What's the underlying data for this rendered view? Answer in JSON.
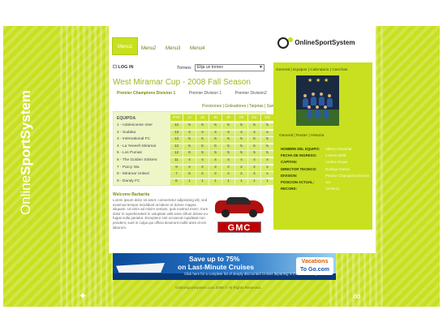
{
  "brand": {
    "prefix": "Online",
    "name": "SportSystem",
    "side_prefix": "Online",
    "side_name": "SportSystem"
  },
  "menu": [
    "Menu1",
    "Menu2",
    "Menu3",
    "Menu4"
  ],
  "login": "LOG IN",
  "season": {
    "label": "Torneo:",
    "selected": "Elija un torneo"
  },
  "page_title": "West Miramar Cup - 2008 Fall Season",
  "divisions": [
    "Premier Champions Division 1",
    "Premier Division 1",
    "Premier Division2"
  ],
  "sub_tabs": "Posiciones | Goleadores | Tarjetas | Sanciones",
  "standings": {
    "header": "EQUIPOA",
    "columns": [
      "PTS",
      "JJ",
      "JG",
      "JE",
      "JP",
      "GF",
      "GC",
      "GD"
    ],
    "rows": [
      {
        "team": "1 - Adolescente Inter",
        "vals": [
          "12",
          "5",
          "5",
          "5",
          "5",
          "5",
          "5",
          "5"
        ]
      },
      {
        "team": "2 - Sudaka",
        "vals": [
          "13",
          "4",
          "4",
          "4",
          "4",
          "4",
          "4",
          "4"
        ]
      },
      {
        "team": "3 - International FC",
        "vals": [
          "12",
          "5",
          "5",
          "5",
          "5",
          "5",
          "5",
          "5"
        ]
      },
      {
        "team": "4 - La Yeeeeh Miramar",
        "vals": [
          "12",
          "6",
          "5",
          "5",
          "5",
          "5",
          "5",
          "5"
        ]
      },
      {
        "team": "5 - Los Pumas",
        "vals": [
          "12",
          "6",
          "5",
          "5",
          "5",
          "5",
          "5",
          "5"
        ]
      },
      {
        "team": "6 - The Golden Strikers",
        "vals": [
          "11",
          "4",
          "4",
          "4",
          "4",
          "4",
          "4",
          "4"
        ]
      },
      {
        "team": "7 - Parcy Wa",
        "vals": [
          "9",
          "4",
          "2",
          "2",
          "2",
          "2",
          "2",
          "2"
        ]
      },
      {
        "team": "8 - Miramar United",
        "vals": [
          "7",
          "6",
          "2",
          "2",
          "2",
          "2",
          "2",
          "2"
        ]
      },
      {
        "team": "9 - Dandy FC",
        "vals": [
          "6",
          "1",
          "1",
          "1",
          "1",
          "1",
          "1",
          "1"
        ]
      }
    ]
  },
  "news": {
    "title": "Welcome Barbarita",
    "body": "Lorem ipsum dolor sit amet, consectetur adipisicing elit, sed eiusmod tempor incididunt ut labore et dolore magna aliquam. Ut enim ad minim veniam, quis nostrud exerc. Irure dolor in reprehenderit in voluptate velit esse cillum dolore eu fugiat nulla pariatur. Excepteur sint occaecat cupidatat non proident, sunt in culpa qui officia deserunt mollit anim id est laborum."
  },
  "ad": {
    "gmc": "GMC"
  },
  "side": {
    "tabs": "General | Equipos | Calendario | Canchas",
    "sub_tabs": "General | Roster | Historia",
    "info": [
      {
        "k": "NOMBRE DEL EQUIPO:",
        "v": "Atletico Nacional"
      },
      {
        "k": "FECHA DE INGRESO:",
        "v": "1 enero 2008"
      },
      {
        "k": "CAPITAN:",
        "v": "Andres Duque"
      },
      {
        "k": "DIRECTOR TECNICO:",
        "v": "Rodrigo Gomez"
      },
      {
        "k": "DIVISION:",
        "v": "Premier Champions Division"
      },
      {
        "k": "POSICION ACTUAL:",
        "v": "1ro"
      },
      {
        "k": "RECORD:",
        "v": "13-05-12"
      }
    ]
  },
  "banner": {
    "line1": "Save up to 75%",
    "line2": "on Last-Minute Cruises",
    "line3": "Click here for a complete list of deeply discounted cruises departing in the next 90 days.",
    "logo_top": "Vacations",
    "logo_bottom": "To Go.com"
  },
  "footer": "OnlineSportSystem.com 2008 © All Rights Reserved.",
  "colors": {
    "accent": "#c8e020",
    "title": "#9fb51a"
  }
}
